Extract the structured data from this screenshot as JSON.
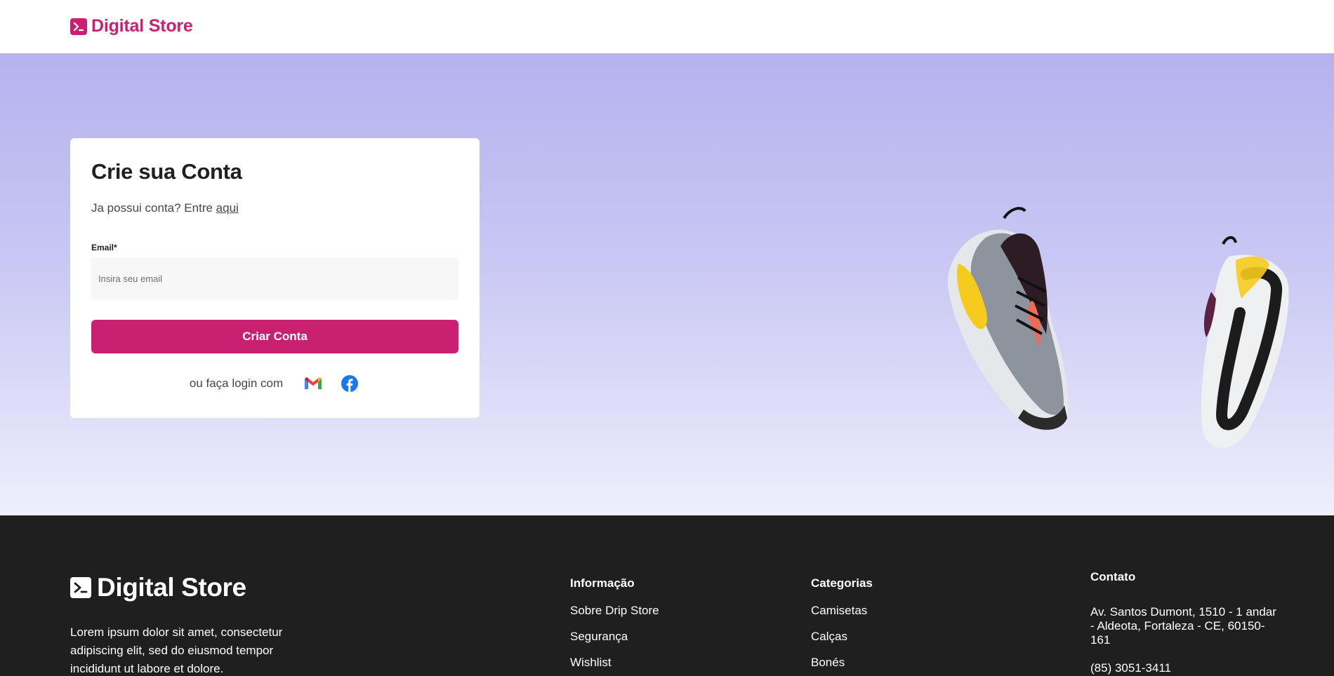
{
  "brand": {
    "name": "Digital Store",
    "color": "#c92071"
  },
  "signup_card": {
    "title": "Crie sua Conta",
    "subtitle_prefix": "Ja possui conta? Entre ",
    "subtitle_link": "aqui",
    "email_label": "Email*",
    "email_placeholder": "Insira seu email",
    "email_value": "",
    "submit_label": "Criar Conta",
    "social_text": "ou faça login com",
    "social_icons": [
      "gmail-icon",
      "facebook-icon"
    ]
  },
  "hero": {
    "image": "sneakers-pair"
  },
  "footer": {
    "brand_name": "Digital Store",
    "description": "Lorem ipsum dolor sit amet, consectetur adipiscing elit, sed do eiusmod tempor incididunt ut labore et dolore.",
    "info": {
      "title": "Informação",
      "links": [
        "Sobre Drip Store",
        "Segurança",
        "Wishlist"
      ]
    },
    "categories": {
      "title": "Categorias",
      "links": [
        "Camisetas",
        "Calças",
        "Bonés"
      ]
    },
    "contact": {
      "title": "Contato",
      "address": "Av. Santos Dumont, 1510 - 1 andar - Aldeota, Fortaleza - CE, 60150-161",
      "phone": "(85) 3051-3411"
    }
  },
  "colors": {
    "primary": "#c92071",
    "footer_bg": "#1f1f1f",
    "hero_top": "#b5b2ef",
    "hero_bottom": "#efeefc"
  }
}
